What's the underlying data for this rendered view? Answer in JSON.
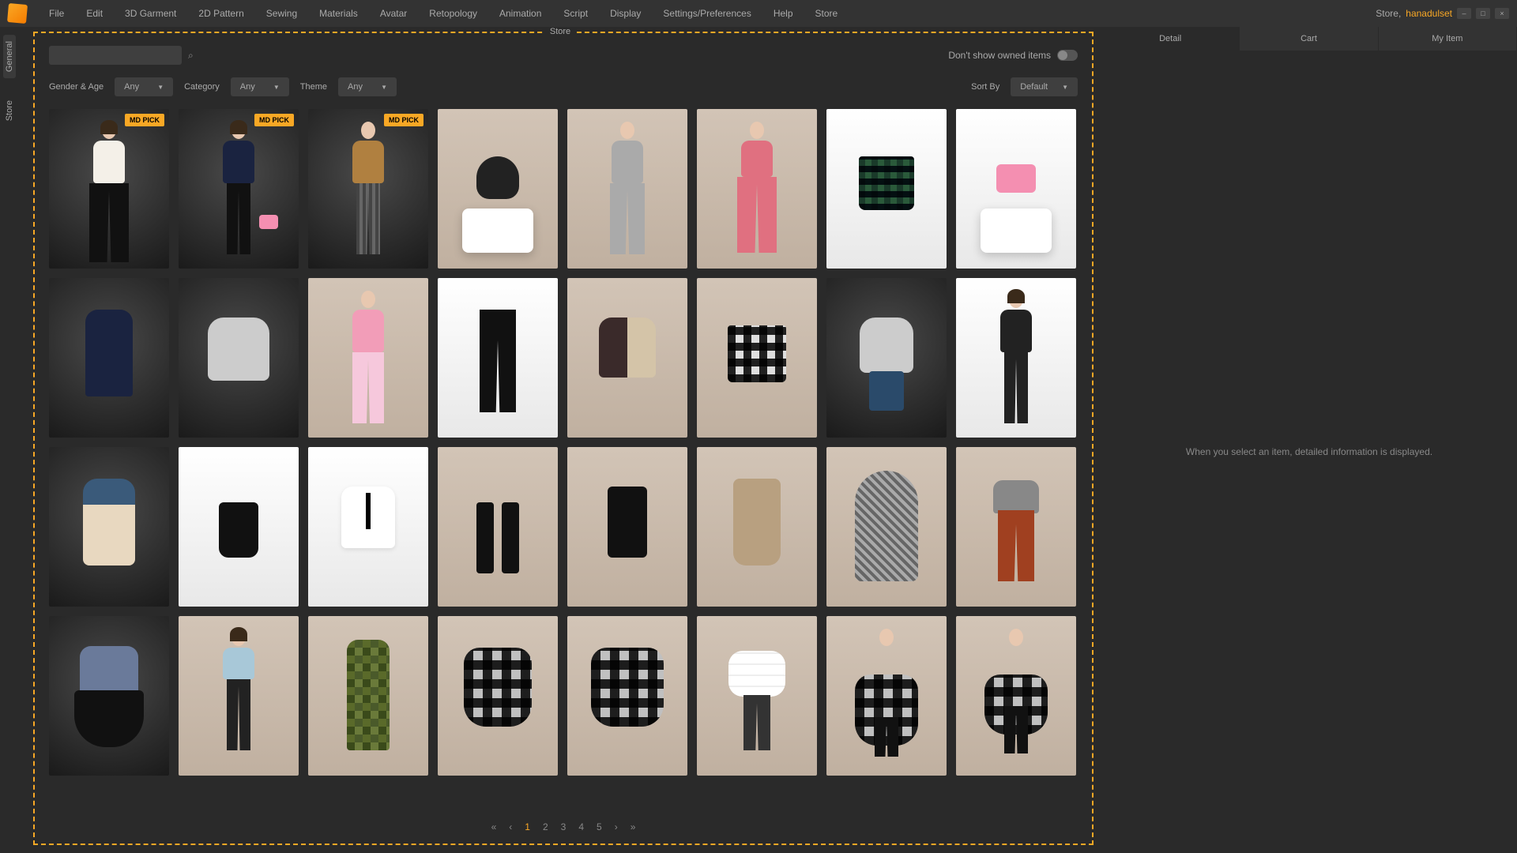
{
  "menubar": {
    "items": [
      "File",
      "Edit",
      "3D Garment",
      "2D Pattern",
      "Sewing",
      "Materials",
      "Avatar",
      "Retopology",
      "Animation",
      "Script",
      "Display",
      "Settings/Preferences",
      "Help",
      "Store"
    ],
    "store_label": "Store,",
    "user": "hanadulset"
  },
  "vtabs": {
    "general": "General",
    "store": "Store"
  },
  "store_label": "Store",
  "toolbar": {
    "search_placeholder": "",
    "dont_show_owned": "Don't show owned items"
  },
  "filters": {
    "gender_label": "Gender & Age",
    "gender_value": "Any",
    "category_label": "Category",
    "category_value": "Any",
    "theme_label": "Theme",
    "theme_value": "Any",
    "sort_label": "Sort By",
    "sort_value": "Default"
  },
  "badge": "MD PICK",
  "pagination": {
    "first": "«",
    "prev": "‹",
    "p1": "1",
    "p2": "2",
    "p3": "3",
    "p4": "4",
    "p5": "5",
    "next": "›",
    "last": "»"
  },
  "rtabs": {
    "detail": "Detail",
    "cart": "Cart",
    "myitem": "My Item"
  },
  "detail_placeholder": "When you select an item, detailed information is displayed."
}
